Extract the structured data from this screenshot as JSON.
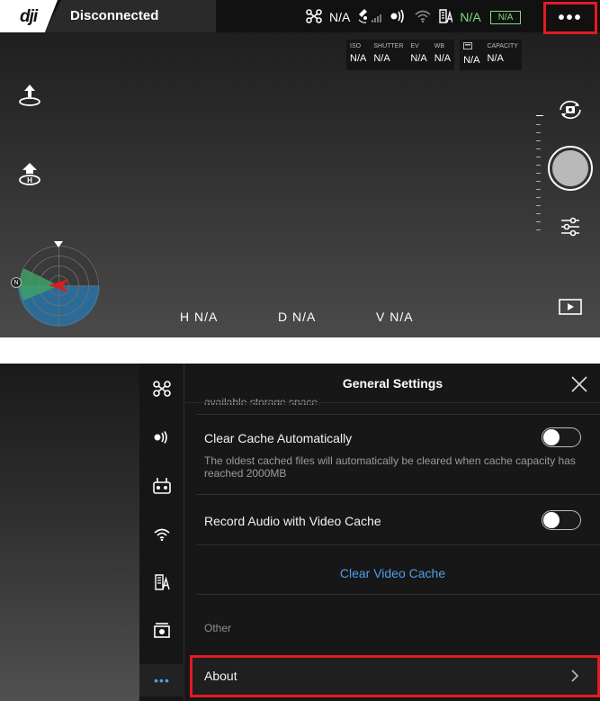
{
  "camera_view": {
    "brand": "dji",
    "connection_status": "Disconnected",
    "status_bar": {
      "aircraft_value": "N/A",
      "rc_signal_value": "N/A",
      "battery_value": "N/A",
      "battery_box_value": "N/A"
    },
    "camera_params": [
      {
        "label": "ISO",
        "value": "N/A"
      },
      {
        "label": "SHUTTER",
        "value": "N/A"
      },
      {
        "label": "EV",
        "value": "N/A"
      },
      {
        "label": "WB",
        "value": "N/A"
      },
      {
        "label": "",
        "value": "N/A"
      },
      {
        "label": "CAPACITY",
        "value": "N/A"
      }
    ],
    "telemetry": {
      "height": "H N/A",
      "distance": "D N/A",
      "vertical_speed": "V N/A"
    },
    "compass_letter": "N"
  },
  "settings_panel": {
    "title": "General Settings",
    "truncated_text": "available storage space.",
    "clear_cache": {
      "title": "Clear Cache Automatically",
      "description": "The oldest cached files will automatically be cleared when cache capacity has reached 2000MB",
      "enabled": false
    },
    "record_audio": {
      "title": "Record Audio with Video Cache",
      "enabled": false
    },
    "clear_video_cache_label": "Clear Video Cache",
    "other_section_label": "Other",
    "about_label": "About"
  },
  "colors": {
    "highlight": "#e21a22",
    "link": "#4d9ee8",
    "battery_green": "#7fdc7f"
  }
}
